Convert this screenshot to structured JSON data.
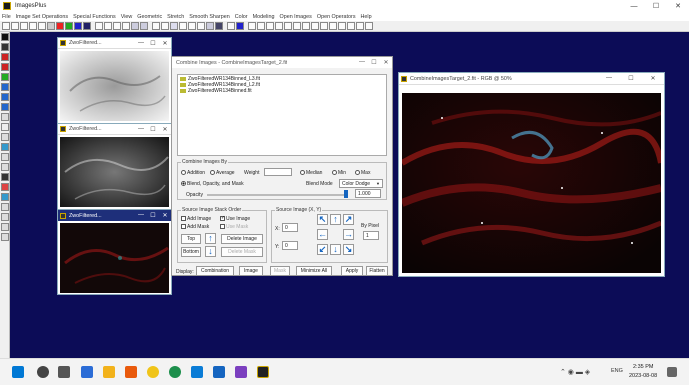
{
  "app": {
    "title": "ImagesPlus",
    "minimize": "—",
    "maximize": "☐",
    "close": "✕"
  },
  "menu": [
    "File",
    "Image Set Operations",
    "Special Functions",
    "View",
    "Geometric",
    "Stretch",
    "Smooth Sharpen",
    "Color",
    "Modeling",
    "Open Images",
    "Open Operators",
    "Help"
  ],
  "thumbs": [
    {
      "title": "ZwoFiltered...",
      "min": "—",
      "max": "☐",
      "close": "✕"
    },
    {
      "title": "ZwoFiltered...",
      "min": "—",
      "max": "☐",
      "close": "✕"
    },
    {
      "title": "ZwoFiltered...",
      "min": "—",
      "max": "☐",
      "close": "✕"
    }
  ],
  "dialog": {
    "title": "Combine Images - CombineImagesTarget_2.fit",
    "min": "—",
    "max": "☐",
    "close": "✕",
    "files": [
      "ZwoFilteredWR134Binned_L3.fit",
      "ZwoFilteredWR134Binned_L2.fit",
      "ZwoFilteredWR134Binned.fit"
    ],
    "combine_group": "Combine Images By",
    "methods": {
      "addition": "Addition",
      "average": "Average",
      "weight": "Weight",
      "median": "Median",
      "min": "Min",
      "max": "Max",
      "blend": "Blend, Opacity, and Mask"
    },
    "blend_mode_label": "Blend Mode",
    "blend_mode_value": "Color Dodge",
    "opacity_label": "Opacity",
    "opacity_value": "1.000",
    "stack_group": "Source Image Stack Order",
    "add_image": "Add Image",
    "use_image": "Use Image",
    "add_mask": "Add Mask",
    "use_mask": "Use Mask",
    "top": "Top",
    "bottom": "Bottom",
    "delete_image": "Delete Image",
    "delete_mask": "Delete Mask",
    "source_group": "Source Image (X, Y)",
    "x_label": "X:",
    "x_value": "0",
    "y_label": "Y:",
    "y_value": "0",
    "by_pixel": "By Pixel",
    "by_pixel_value": "1",
    "display_label": "Display:",
    "combination": "Combination",
    "image": "Image",
    "mask": "Mask",
    "minimize_all": "Minimize All",
    "apply": "Apply",
    "flatten": "Flatten"
  },
  "target": {
    "title": "CombineImagesTarget_2.fit - RGB @ 50%",
    "min": "—",
    "max": "☐",
    "close": "✕"
  },
  "taskbar": {
    "time": "2:35 PM",
    "date": "2023-08-08",
    "lang": "ENG"
  }
}
